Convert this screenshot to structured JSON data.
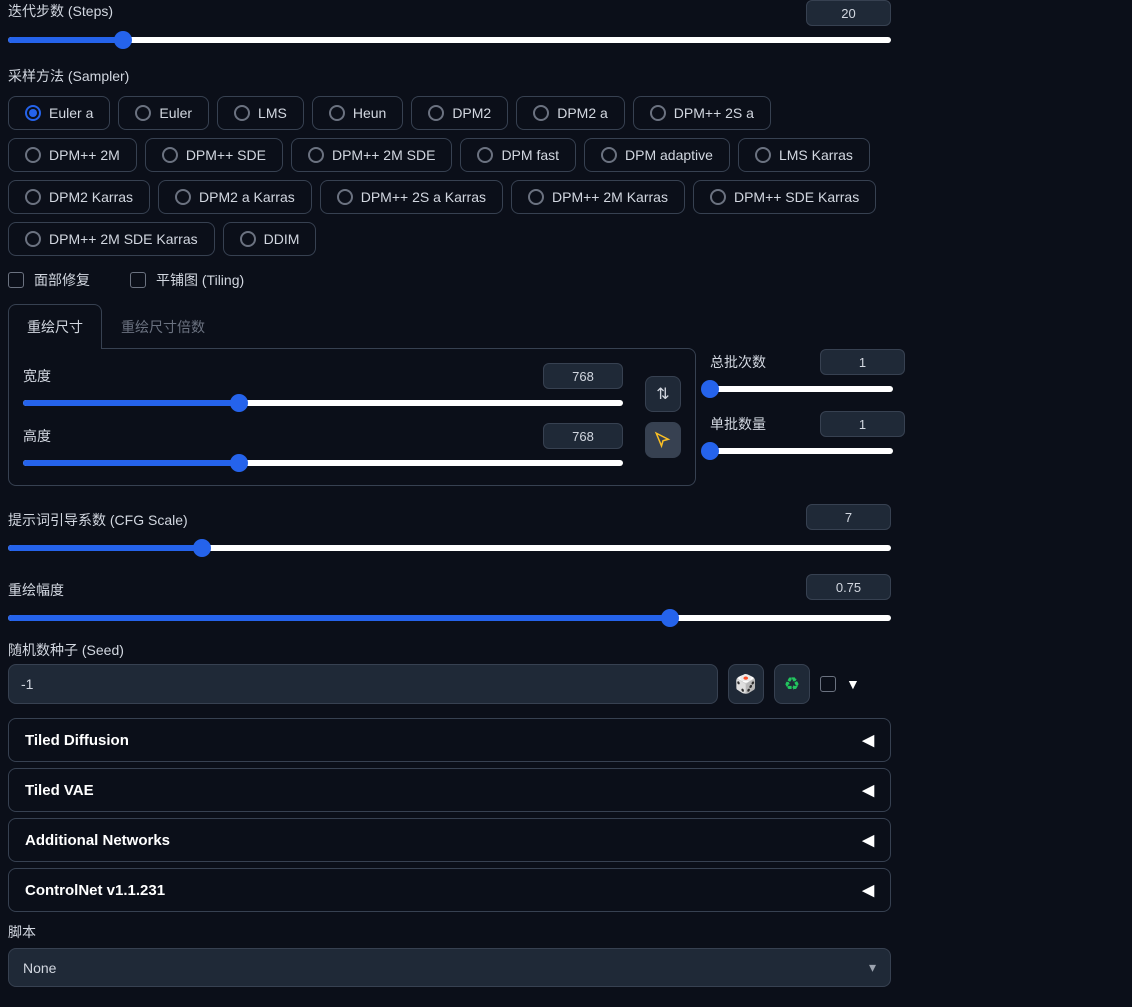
{
  "steps": {
    "label": "迭代步数 (Steps)",
    "value": "20",
    "fill_pct": 13
  },
  "sampler": {
    "label": "采样方法 (Sampler)",
    "options": [
      "Euler a",
      "Euler",
      "LMS",
      "Heun",
      "DPM2",
      "DPM2 a",
      "DPM++ 2S a",
      "DPM++ 2M",
      "DPM++ SDE",
      "DPM++ 2M SDE",
      "DPM fast",
      "DPM adaptive",
      "LMS Karras",
      "DPM2 Karras",
      "DPM2 a Karras",
      "DPM++ 2S a Karras",
      "DPM++ 2M Karras",
      "DPM++ SDE Karras",
      "DPM++ 2M SDE Karras",
      "DDIM"
    ],
    "selected": 0
  },
  "checkboxes": {
    "face": "面部修复",
    "tiling": "平铺图 (Tiling)"
  },
  "tabs": {
    "resize": "重绘尺寸",
    "resize_by": "重绘尺寸倍数"
  },
  "size": {
    "width_label": "宽度",
    "width_value": "768",
    "width_fill_pct": 36,
    "height_label": "高度",
    "height_value": "768",
    "height_fill_pct": 36,
    "swap_icon": "⇅",
    "crop_icon": "▷"
  },
  "batch": {
    "count_label": "总批次数",
    "count_value": "1",
    "count_fill_pct": 0,
    "size_label": "单批数量",
    "size_value": "1",
    "size_fill_pct": 0
  },
  "cfg": {
    "label": "提示词引导系数 (CFG Scale)",
    "value": "7",
    "fill_pct": 22
  },
  "denoise": {
    "label": "重绘幅度",
    "value": "0.75",
    "fill_pct": 75
  },
  "seed": {
    "label": "随机数种子 (Seed)",
    "value": "-1",
    "dice": "🎲",
    "recycle": "♻",
    "caret": "▼"
  },
  "accordions": [
    "Tiled Diffusion",
    "Tiled VAE",
    "Additional Networks",
    "ControlNet v1.1.231"
  ],
  "script": {
    "label": "脚本",
    "value": "None",
    "caret": "▾"
  }
}
